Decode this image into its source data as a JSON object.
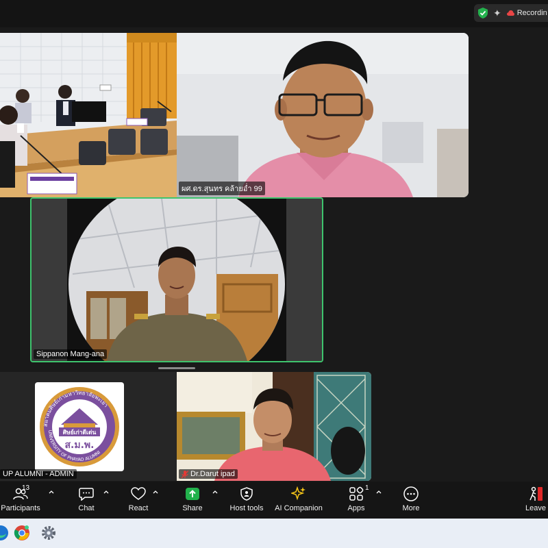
{
  "top_bar": {
    "recording_label": "Recordin"
  },
  "tiles": {
    "room": {
      "name": ""
    },
    "remote1": {
      "name": "ผศ.ดร.สุนทร คล้ายอ่ำ 99"
    },
    "speaker": {
      "name": "Sippanon Mang-ana"
    },
    "logo": {
      "name": "UP ALUMNI - ADMIN",
      "logo_text_top": "สมาคมศิษย์เก่ามหาวิทยาลัยพะเยา",
      "logo_text_mid": "ศิษย์เก่าดีเด่น",
      "logo_abbr": "ส.ม.พ.",
      "logo_text_bottom": "UNIVERSITY OF PHAYAO ALUMNI"
    },
    "remote3": {
      "name": "Dr.Darut ipad"
    }
  },
  "toolbar": {
    "participants_label": "Participants",
    "participants_count": "13",
    "chat_label": "Chat",
    "react_label": "React",
    "share_label": "Share",
    "host_tools_label": "Host tools",
    "ai_companion_label": "AI Companion",
    "apps_label": "Apps",
    "apps_count": "1",
    "more_label": "More",
    "leave_label": "Leave"
  },
  "colors": {
    "active_speaker_border": "#3ec46d",
    "share_green": "#22b24c",
    "toolbar_bg": "#151515",
    "leave_red": "#e02828"
  },
  "taskbar": {
    "icons": [
      "edge-icon",
      "chrome-icon",
      "settings-icon"
    ]
  }
}
